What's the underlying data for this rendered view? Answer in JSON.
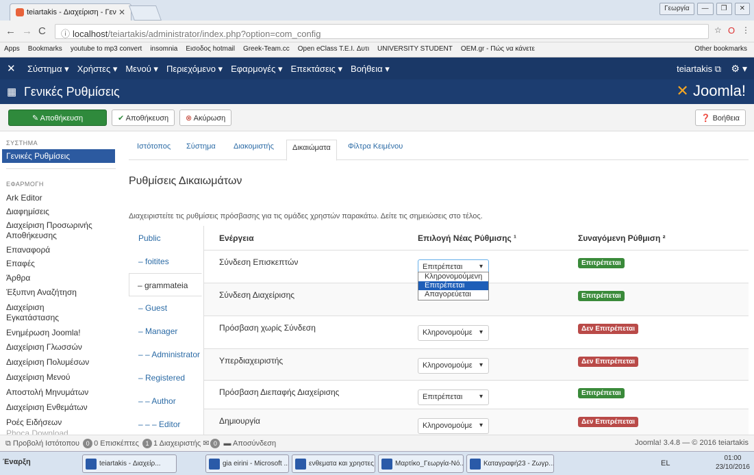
{
  "browser": {
    "tab_title": "teiartakis - Διαχείριση - Γεν",
    "url_prefix": "ⓘ",
    "url_host": "localhost",
    "url_path": "/teiartakis/administrator/index.php?option=com_config",
    "user_chip": "Γεωργία",
    "bookmarks": [
      "Apps",
      "Bookmarks",
      "youtube to mp3 convert",
      "insomnia",
      "Εισοδος hotmail",
      "Greek-Team.cc",
      "Open eClass T.E.I. Δυτι",
      "UNIVERSITY STUDENT",
      "OEM.gr - Πώς να κάνετε"
    ],
    "other_bookmarks": "Other bookmarks"
  },
  "jnav": {
    "menu": [
      "Σύστημα ▾",
      "Χρήστες ▾",
      "Μενού ▾",
      "Περιεχόμενο ▾",
      "Εφαρμογές ▾",
      "Επεκτάσεις ▾",
      "Βοήθεια ▾"
    ],
    "user": "teiartakis ⧉",
    "gear": "⚙ ▾"
  },
  "header": {
    "title": "Γενικές Ρυθμίσεις",
    "brand_part1": "Joomla!",
    "brand_mark": "✕"
  },
  "toolbar": {
    "save_close": "Αποθήκευση",
    "save": "Αποθήκευση",
    "cancel": "Ακύρωση",
    "help": "Βοήθεια"
  },
  "sidebar": {
    "system_heading": "ΣΥΣΤΗΜΑ",
    "system_active": "Γενικές Ρυθμίσεις",
    "apps_heading": "ΕΦΑΡΜΟΓΗ",
    "items": [
      "Ark Editor",
      "Διαφημίσεις",
      "Διαχείριση Προσωρινής",
      "Αποθήκευσης",
      "Επαναφορά",
      "Επαφές",
      "Άρθρα",
      "Έξυπνη Αναζήτηση",
      "Διαχείριση",
      "Εγκατάστασης",
      "Ενημέρωση Joomla!",
      "Διαχείριση Γλωσσών",
      "Διαχείριση Πολυμέσων",
      "Διαχείριση Μενού",
      "Αποστολή Μηνυμάτων",
      "Διαχείριση Ενθεμάτων",
      "Ροές Ειδήσεων",
      "Phoca Download"
    ]
  },
  "tabs": [
    "Ιστότοπος",
    "Σύστημα",
    "Διακομιστής",
    "Δικαιώματα",
    "Φίλτρα Κειμένου"
  ],
  "main": {
    "heading": "Ρυθμίσεις Δικαιωμάτων",
    "description": "Διαχειριστείτε τις ρυθμίσεις πρόσβασης για τις ομάδες χρηστών παρακάτω. Δείτε τις σημειώσεις στο τέλος.",
    "groups": [
      "Public",
      "– foitites",
      "– grammateia",
      "– Guest",
      "– Manager",
      "– – Administrator",
      "– Registered",
      "– – Author",
      "– – – Editor"
    ],
    "columns": {
      "action": "Ενέργεια",
      "new_setting": "Επιλογή Νέας Ρύθμισης ¹",
      "calculated": "Συναγόμενη Ρύθμιση ²"
    },
    "rows": [
      {
        "action": "Σύνδεση Επισκεπτών",
        "value": "Επιτρέπεται",
        "badge": "Επιτρέπεται",
        "color": "#3a8a3a"
      },
      {
        "action": "Σύνδεση Διαχείρισης",
        "value": "",
        "badge": "Επιτρέπεται",
        "color": "#3a8a3a"
      },
      {
        "action": "Πρόσβαση χωρίς Σύνδεση",
        "value": "Κληρονομούμε",
        "badge": "Δεν Επιτρέπεται",
        "color": "#b94a48"
      },
      {
        "action": "Υπερδιαχειριστής",
        "value": "Κληρονομούμε",
        "badge": "Δεν Επιτρέπεται",
        "color": "#b94a48"
      },
      {
        "action": "Πρόσβαση Διεπαφής Διαχείρισης",
        "value": "Επιτρέπεται",
        "badge": "Επιτρέπεται",
        "color": "#3a8a3a"
      },
      {
        "action": "Δημιουργία",
        "value": "Κληρονομούμε",
        "badge": "Δεν Επιτρέπεται",
        "color": "#b94a48"
      }
    ],
    "dropdown_options": [
      "Κληρονομούμενη",
      "Επιτρέπεται",
      "Απαγορεύεται"
    ]
  },
  "status": {
    "view_site": "Προβολή Ιστότοπου",
    "visitors_count": "0",
    "visitors_label": "0 Επισκέπτες",
    "admins_count": "1",
    "admins_label": "1 Διαχειριστής",
    "messages_count": "0",
    "logout": "Αποσύνδεση",
    "version": "Joomla! 3.4.8 — © 2016 teiartakis"
  },
  "taskbar": {
    "start": "Έναρξη",
    "items": [
      "teiartakis - Διαχείρ...",
      "gia eirini - Microsoft ...",
      "ενθεματα και χρηστες...",
      "Μαρτίκο_Γεωργία-Νό...",
      "Καταγραφή23 - Ζωγρ..."
    ],
    "lang": "EL",
    "time": "01:00",
    "date": "23/10/2016"
  }
}
